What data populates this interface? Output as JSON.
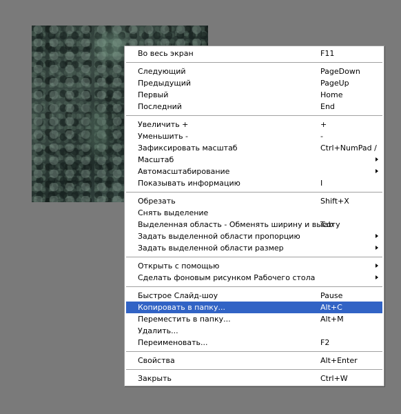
{
  "menu": {
    "groups": [
      [
        {
          "label": "Во весь экран",
          "shortcut": "F11"
        }
      ],
      [
        {
          "label": "Следующий",
          "shortcut": "PageDown"
        },
        {
          "label": "Предыдущий",
          "shortcut": "PageUp"
        },
        {
          "label": "Первый",
          "shortcut": "Home"
        },
        {
          "label": "Последний",
          "shortcut": "End"
        }
      ],
      [
        {
          "label": "Увеличить +",
          "shortcut": "+"
        },
        {
          "label": "Уменьшить -",
          "shortcut": "-"
        },
        {
          "label": "Зафиксировать масштаб",
          "shortcut": "Ctrl+NumPad /"
        },
        {
          "label": "Масштаб",
          "shortcut": "",
          "submenu": true
        },
        {
          "label": "Автомасштабирование",
          "shortcut": "",
          "submenu": true
        },
        {
          "label": "Показывать информацию",
          "shortcut": "I"
        }
      ],
      [
        {
          "label": "Обрезать",
          "shortcut": "Shift+X"
        },
        {
          "label": "Снять выделение",
          "shortcut": ""
        },
        {
          "label": "Выделенная область - Обменять ширину и высоту",
          "shortcut": "Tab"
        },
        {
          "label": "Задать выделенной области пропорцию",
          "shortcut": "",
          "submenu": true
        },
        {
          "label": "Задать выделенной области размер",
          "shortcut": "",
          "submenu": true
        }
      ],
      [
        {
          "label": "Открыть с помощью",
          "shortcut": "",
          "submenu": true
        },
        {
          "label": "Сделать фоновым рисунком Рабочего стола",
          "shortcut": "",
          "submenu": true
        }
      ],
      [
        {
          "label": "Быстрое Слайд-шоу",
          "shortcut": "Pause"
        },
        {
          "label": "Копировать в папку...",
          "shortcut": "Alt+C",
          "highlighted": true
        },
        {
          "label": "Переместить в папку...",
          "shortcut": "Alt+M"
        },
        {
          "label": "Удалить...",
          "shortcut": ""
        },
        {
          "label": "Переименовать...",
          "shortcut": "F2"
        }
      ],
      [
        {
          "label": "Свойства",
          "shortcut": "Alt+Enter"
        }
      ],
      [
        {
          "label": "Закрыть",
          "shortcut": "Ctrl+W"
        }
      ]
    ]
  },
  "colors": {
    "background": "#7a7a7a",
    "highlight": "#3163c5"
  }
}
